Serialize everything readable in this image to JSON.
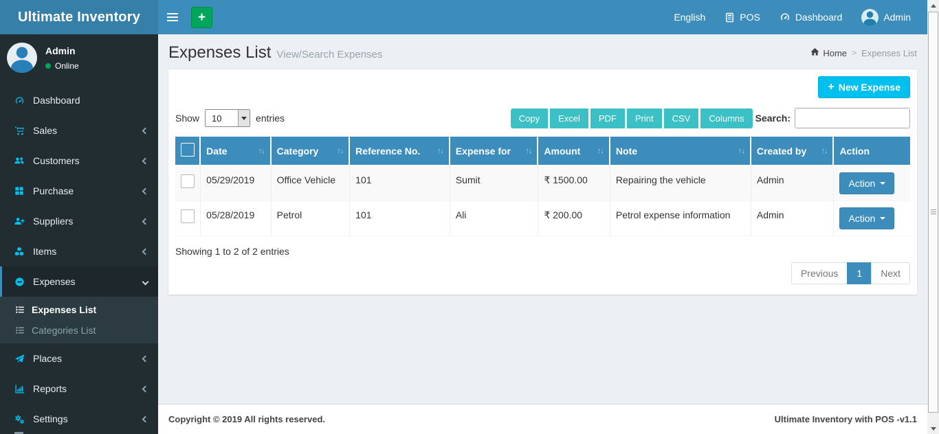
{
  "app": {
    "brand": "Ultimate Inventory",
    "copyright": "Copyright © 2019 All rights reserved.",
    "version_label": "Ultimate Inventory with POS -v1.1"
  },
  "icons": {
    "plus": "+",
    "sort": "↑↓"
  },
  "topnav": {
    "language": "English",
    "pos": "POS",
    "dashboard": "Dashboard",
    "user": "Admin"
  },
  "sidebar": {
    "user_name": "Admin",
    "user_status": "Online",
    "items": [
      {
        "label": "Dashboard"
      },
      {
        "label": "Sales"
      },
      {
        "label": "Customers"
      },
      {
        "label": "Purchase"
      },
      {
        "label": "Suppliers"
      },
      {
        "label": "Items"
      },
      {
        "label": "Expenses"
      },
      {
        "label": "Places"
      },
      {
        "label": "Reports"
      },
      {
        "label": "Settings"
      }
    ],
    "expenses_submenu": [
      {
        "label": "Expenses List"
      },
      {
        "label": "Categories List"
      }
    ]
  },
  "page": {
    "title": "Expenses List",
    "subtitle": "View/Search Expenses",
    "breadcrumb": {
      "home": "Home",
      "separator": ">",
      "current": "Expenses List"
    },
    "new_expense": "New Expense"
  },
  "toolbar": {
    "show": "Show",
    "entries_value": "10",
    "entries": "entries",
    "export": [
      "Copy",
      "Excel",
      "PDF",
      "Print",
      "CSV",
      "Columns"
    ],
    "search_label": "Search:",
    "search_value": ""
  },
  "table": {
    "columns": [
      "Date",
      "Category",
      "Reference No.",
      "Expense for",
      "Amount",
      "Note",
      "Created by",
      "Action"
    ],
    "rows": [
      {
        "date": "05/29/2019",
        "category": "Office Vehicle",
        "reference_no": "101",
        "expense_for": "Sumit",
        "amount": "₹ 1500.00",
        "note": "Repairing the vehicle",
        "created_by": "Admin",
        "action": "Action"
      },
      {
        "date": "05/28/2019",
        "category": "Petrol",
        "reference_no": "101",
        "expense_for": "Ali",
        "amount": "₹ 200.00",
        "note": "Petrol expense information",
        "created_by": "Admin",
        "action": "Action"
      }
    ],
    "summary": "Showing 1 to 2 of 2 entries",
    "pagination": {
      "previous": "Previous",
      "page": "1",
      "next": "Next"
    }
  },
  "colors": {
    "header": "#3c8dbc",
    "logo_bg": "#367fa9",
    "sidebar_bg": "#222d32",
    "sidebar_active_bg": "#1e282c",
    "submenu_bg": "#2c3b41",
    "icon_accent": "#00c0ef",
    "success_green": "#00a65a",
    "info_cyan": "#00c0ef",
    "export_teal": "#3bc1c5",
    "table_header": "#3c8dbc",
    "content_bg": "#ecf0f5",
    "footer_text": "#444444"
  }
}
